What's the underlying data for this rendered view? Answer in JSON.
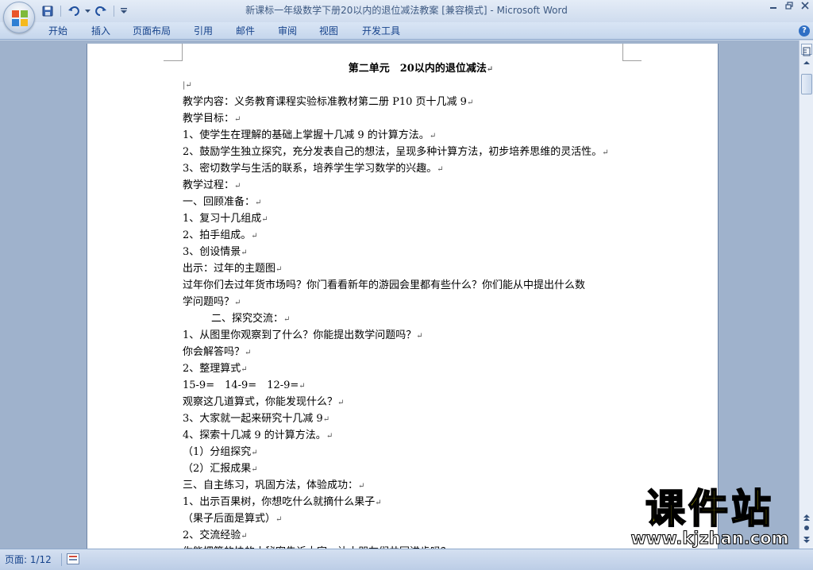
{
  "window": {
    "title": "新课标一年级数学下册20以内的退位减法教案 [兼容模式]",
    "app_name": "Microsoft Word",
    "title_sep": " - "
  },
  "quick_access": {
    "icons": [
      "save-icon",
      "undo-icon",
      "redo-icon",
      "customize-icon"
    ]
  },
  "ribbon": {
    "tabs": [
      "开始",
      "插入",
      "页面布局",
      "引用",
      "邮件",
      "审阅",
      "视图",
      "开发工具"
    ],
    "help_label": "?"
  },
  "document": {
    "title": "第二单元　20以内的退位减法",
    "paragraph_mark": "↵",
    "lines": [
      {
        "text": "教学内容：义务教育课程实验标准教材第二册 P10 页十几减 9",
        "indent": false
      },
      {
        "text": "教学目标：",
        "indent": false
      },
      {
        "text": "1、使学生在理解的基础上掌握十几减 9 的计算方法。",
        "indent": false
      },
      {
        "text": "2、鼓励学生独立探究，充分发表自己的想法，呈现多种计算方法，初步培养思维的灵活性。",
        "indent": false
      },
      {
        "text": "3、密切数学与生活的联系，培养学生学习数学的兴趣。",
        "indent": false
      },
      {
        "text": "教学过程：",
        "indent": false
      },
      {
        "text": "一、回顾准备：",
        "indent": false
      },
      {
        "text": "1、复习十几组成",
        "indent": false
      },
      {
        "text": "2、拍手组成。",
        "indent": false
      },
      {
        "text": "3、创设情景",
        "indent": false
      },
      {
        "text": "出示：过年的主题图",
        "indent": false
      },
      {
        "text": "过年你们去过年货市场吗？你门看看新年的游园会里都有些什么？你们能从中提出什么数",
        "indent": false,
        "no_mark": true
      },
      {
        "text": "学问题吗？",
        "indent": false
      },
      {
        "text": "二、探究交流：",
        "indent": true
      },
      {
        "text": "1、从图里你观察到了什么？你能提出数学问题吗？",
        "indent": false
      },
      {
        "text": "你会解答吗？",
        "indent": false
      },
      {
        "text": "2、整理算式",
        "indent": false
      },
      {
        "text": "15-9=　14-9=　12-9=",
        "indent": false
      },
      {
        "text": "观察这几道算式，你能发现什么？",
        "indent": false
      },
      {
        "text": "3、大家就一起来研究十几减 9",
        "indent": false
      },
      {
        "text": "4、探索十几减 9 的计算方法。",
        "indent": false
      },
      {
        "text": "（1）分组探究",
        "indent": false
      },
      {
        "text": "（2）汇报成果",
        "indent": false
      },
      {
        "text": "三、自主练习，巩固方法，体验成功：",
        "indent": false
      },
      {
        "text": "1、出示百果树，你想吃什么就摘什么果子",
        "indent": false
      },
      {
        "text": "（果子后面是算式）",
        "indent": false
      },
      {
        "text": "2、交流经验",
        "indent": false
      },
      {
        "text": "你能把算的快的小秘密告诉大家，让小朋友们共同进步吗？",
        "indent": false
      }
    ]
  },
  "statusbar": {
    "page_info": "页面: 1/12"
  },
  "watermark": {
    "brand": "课件站",
    "url": "www.kjzhan.com"
  },
  "colors": {
    "ribbon_text": "#15428b",
    "workspace": "#9fb2cc",
    "watermark_yellow": "#fff200"
  }
}
